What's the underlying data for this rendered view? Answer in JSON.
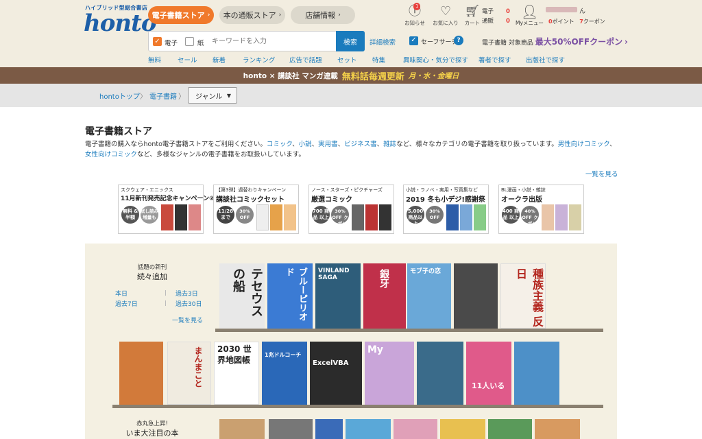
{
  "header": {
    "logo_sub": "ハイブリッド型総合書店",
    "logo": "honto",
    "tabs": [
      "電子書籍ストア",
      "本の通販ストア",
      "店舗情報"
    ],
    "icons": {
      "notice": {
        "label": "お知らせ",
        "badge": "1"
      },
      "favorite": {
        "label": "お気に入り"
      },
      "cart": {
        "label": "カート"
      }
    },
    "cart_counts": {
      "ebook_label": "電子",
      "ebook_count": "0",
      "print_label": "通販",
      "print_count": "0"
    },
    "mymenu": "Myメニュー",
    "user_suffix": "ん",
    "points": {
      "points_value": "0",
      "points_label": "ポイント",
      "coupon_value": "7",
      "coupon_label": "クーポン"
    },
    "search": {
      "ebook_label": "電子",
      "paper_label": "紙",
      "placeholder": "キーワードを入力",
      "button": "検索",
      "advanced": "詳細検索",
      "safe_search": "セーフサーチ",
      "help": "?"
    },
    "promo": {
      "prefix": "電子書籍 対象商品",
      "highlight": "最大50%OFFクーポン",
      "arrow": "›"
    },
    "categories": [
      "無料",
      "セール",
      "新着",
      "ランキング",
      "広告で話題",
      "セット",
      "特集",
      "興味関心・気分で探す",
      "著者で探す",
      "出版社で探す"
    ]
  },
  "banner": {
    "prefix": "honto × 講談社 マンガ連載",
    "highlight": "無料話毎週更新",
    "days": "月・水・金曜日"
  },
  "breadcrumb": {
    "home": "hontoトップ",
    "current": "電子書籍",
    "genre": "ジャンル"
  },
  "main": {
    "title": "電子書籍ストア",
    "desc_1": "電子書籍の購入ならhonto電子書籍ストアをご利用ください。",
    "desc_links": [
      "コミック",
      "小説",
      "実用書",
      "ビジネス書",
      "雑誌"
    ],
    "desc_2": "など、様々なカテゴリの電子書籍を取り扱っています。",
    "desc_links2": [
      "男性向けコミック",
      "女性向けコミック"
    ],
    "desc_3": "など、多様なジャンルの電子書籍をお取扱いしています。",
    "see_all": "一覧を見る"
  },
  "campaigns": [
    {
      "publisher": "スクウェア・エニックス",
      "title": "11月新刊発売記念キャンペーン②",
      "badge1": "無料 & 半額",
      "badge2": "試し読み 増量も"
    },
    {
      "publisher": "【第3弾】週替わりキャンペーン",
      "title": "講談社コミックセット",
      "badge1": "11/28 まで",
      "badge2": "30% OFF"
    },
    {
      "publisher": "ノース・スターズ・ピクチャーズ",
      "title": "厳選コミック",
      "badge1": "700 商品 以上",
      "badge2": "30% OFF クーポン"
    },
    {
      "publisher": "小説・ラノベ・実用・写真集など",
      "title": "2019 冬も小デジ!感謝祭",
      "badge1": "5,000 商品以上",
      "badge2": "30% OFF"
    },
    {
      "publisher": "BL漫画・小説・雑誌",
      "title": "オークラ出版",
      "badge1": "400 商品 以上",
      "badge2": "40% OFF クーポン"
    }
  ],
  "shelf1": {
    "sub": "話題の新刊",
    "title": "続々追加",
    "periods": [
      "本日",
      "過去3日",
      "過去7日",
      "過去30日"
    ],
    "see_all": "一覧を見る",
    "books": [
      {
        "title": "テセウスの船",
        "color": "#e8e8e8"
      },
      {
        "title": "ブルーピリオド",
        "color": "#3b7bd4"
      },
      {
        "title": "VINLAND SAGA",
        "color": "#2e5d7a"
      },
      {
        "title": "銀牙",
        "color": "#c0304a"
      },
      {
        "title": "モブ子の恋",
        "color": "#6aa8d8"
      },
      {
        "title": "",
        "color": "#4a4a4a"
      },
      {
        "title": "種族主義 反日",
        "color": "#f5f0e8"
      }
    ]
  },
  "shelf2": {
    "books": [
      {
        "title": "",
        "color": "#d27a3a"
      },
      {
        "title": "まんまこと",
        "color": "#f0ebe0"
      },
      {
        "title": "2030 世界地図帳",
        "color": "#ffffff"
      },
      {
        "title": "1兆ドルコーチ",
        "color": "#2a68b8"
      },
      {
        "title": "ExcelVBA",
        "color": "#2b2b2b"
      },
      {
        "title": "My",
        "color": "#c9a5d9"
      },
      {
        "title": "",
        "color": "#3a6b8a"
      },
      {
        "title": "11人いる",
        "color": "#e05a8a"
      },
      {
        "title": "",
        "color": "#4d90c8"
      }
    ]
  },
  "shelf3": {
    "sub": "赤丸急上昇!",
    "title": "いま大注目の本"
  }
}
